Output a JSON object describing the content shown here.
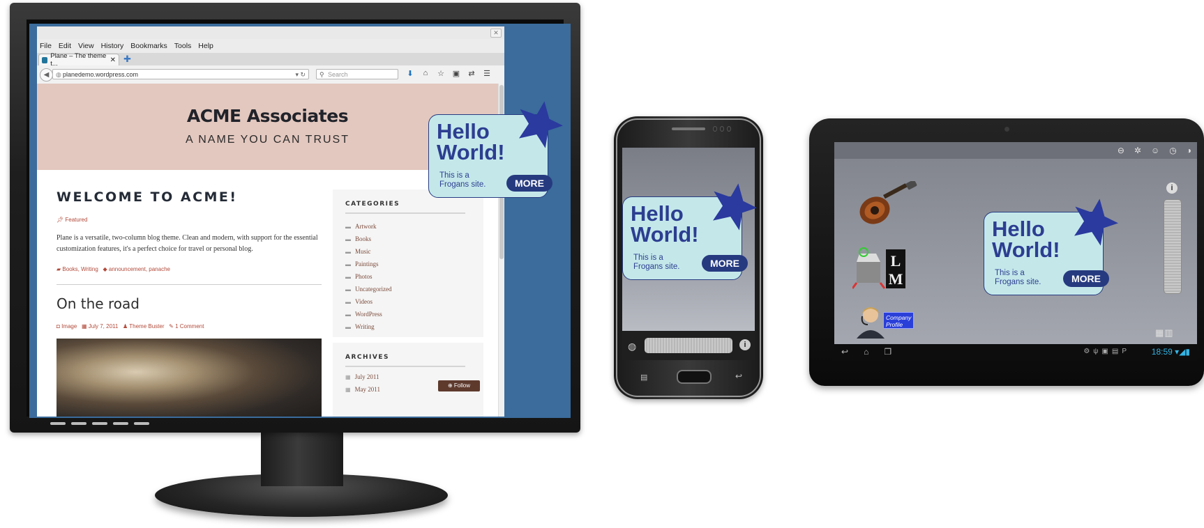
{
  "browser": {
    "menu": [
      "File",
      "Edit",
      "View",
      "History",
      "Bookmarks",
      "Tools",
      "Help"
    ],
    "tab_title": "Plane – The theme t...",
    "url": "planedemo.wordpress.com",
    "search_placeholder": "Search"
  },
  "site": {
    "title": "ACME Associates",
    "tagline": "A NAME YOU CAN TRUST",
    "post1": {
      "title": "WELCOME TO ACME!",
      "featured": "Featured",
      "excerpt": "Plane is a versatile, two-column blog theme. Clean and modern, with support for the essential customization features, it's a perfect choice for travel or personal blog.",
      "cats": "Books, Writing",
      "tags": "announcement, panache"
    },
    "post2": {
      "title": "On the road",
      "format": "Image",
      "date": "July 7, 2011",
      "author": "Theme Buster",
      "comments": "1 Comment"
    },
    "sidebar": {
      "categories_title": "CATEGORIES",
      "categories": [
        "Artwork",
        "Books",
        "Music",
        "Paintings",
        "Photos",
        "Uncategorized",
        "Videos",
        "WordPress",
        "Writing"
      ],
      "archives_title": "ARCHIVES",
      "archives": [
        "July 2011",
        "May 2011"
      ]
    },
    "follow_label": "Follow"
  },
  "frogans_card": {
    "line1": "Hello",
    "line2": "World!",
    "sub1": "This is a",
    "sub2": "Frogans site.",
    "more_label": "MORE"
  },
  "tablet": {
    "clock": "18:59",
    "company_label_1": "Company",
    "company_label_2": "Profile",
    "lm_label": "LM"
  },
  "colors": {
    "card_bg": "#c4e8ea",
    "card_text": "#2c3e91",
    "star": "#2a3a9e",
    "hero_bg": "#e3c8bf",
    "desktop_bg": "#3b6c9c",
    "clock": "#33b5e5"
  }
}
